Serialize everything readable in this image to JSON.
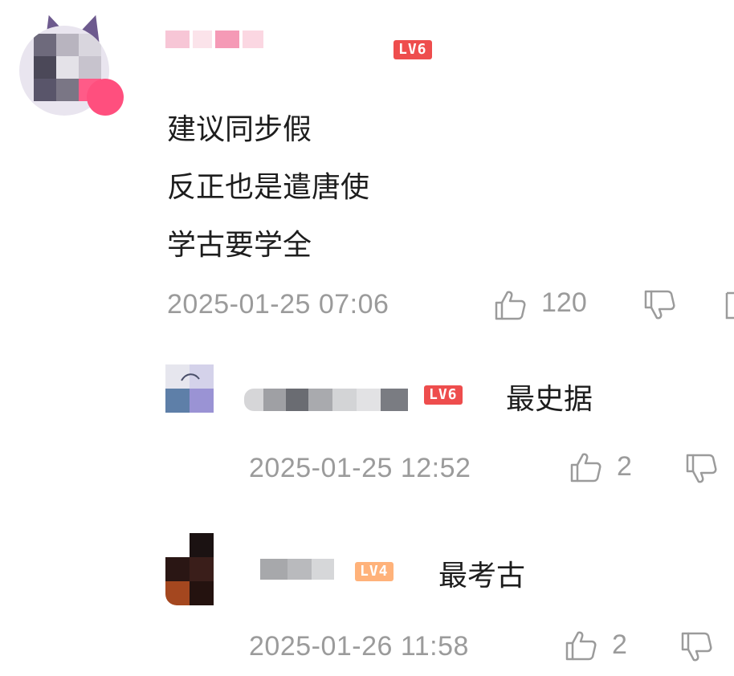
{
  "main_comment": {
    "level": "LV6",
    "lines": [
      "建议同步假",
      "反正也是遣唐使",
      "学古要学全"
    ],
    "timestamp": "2025-01-25 07:06",
    "likes": "120"
  },
  "replies": [
    {
      "level": "LV6",
      "text": "最史据",
      "timestamp": "2025-01-25 12:52",
      "likes": "2"
    },
    {
      "level": "LV4",
      "text": "最考古",
      "timestamp": "2025-01-26 11:58",
      "likes": "2"
    }
  ],
  "icons": {
    "like": "thumbs-up-icon",
    "dislike": "thumbs-down-icon",
    "more": "reply-icon"
  },
  "colors": {
    "level6": "#ee4d4d",
    "level4": "#ffb27a",
    "meta_text": "#9b9b9b"
  }
}
